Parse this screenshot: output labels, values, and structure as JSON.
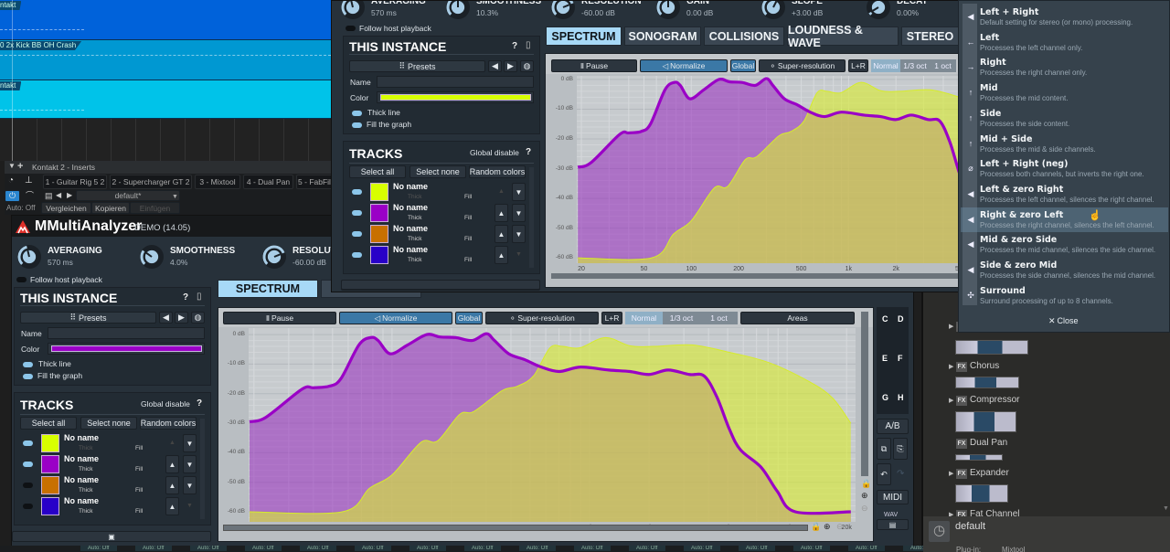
{
  "daw": {
    "clips": [
      "ntakt",
      "0 2x Kick BB OH Crash",
      "ntakt"
    ],
    "clip_colors": [
      "#0062da",
      "#0098d2",
      "#00c3e9"
    ]
  },
  "inserts": {
    "title": "Kontakt 2 - Inserts",
    "tabs": [
      "1 - Guitar Rig 5 2",
      "2 - Supercharger GT 2",
      "3 - Mixtool",
      "4 - Dual Pan",
      "5 - FabFil"
    ],
    "preset": "default*",
    "auto": "Auto: Off",
    "compare": "Vergleichen",
    "copy": "Kopieren",
    "paste": "Einfügen"
  },
  "plugin": {
    "name": "MMultiAnalyzer",
    "edition": "DEMO (14.05)"
  },
  "tracks_panel": {
    "title": "TRACKS",
    "global": "Global disable",
    "help": "?",
    "select_all": "Select all",
    "select_none": "Select none",
    "random": "Random colors",
    "thick": "Thick",
    "fill": "Fill",
    "items": [
      {
        "name": "No name",
        "color": "#d8ff00"
      },
      {
        "name": "No name",
        "color": "#9a00c6"
      },
      {
        "name": "No name",
        "color": "#c87000"
      },
      {
        "name": "No name",
        "color": "#2800c8"
      }
    ]
  },
  "instance_panel": {
    "title": "THIS INSTANCE",
    "help": "?",
    "presets": "Presets",
    "name_label": "Name",
    "color_label": "Color",
    "thick": "Thick line",
    "fill": "Fill the graph"
  },
  "toolbar": {
    "pause": "Pause",
    "normalize": "Normalize",
    "global": "Global",
    "superres": "Super-resolution",
    "lr": "L+R",
    "modes": [
      "Normal",
      "1/3 oct",
      "1 oct"
    ],
    "areas": "Areas"
  },
  "front": {
    "follow": "Follow host playback",
    "instance_color": "#9a00c6",
    "track_enabled": [
      true,
      true,
      false,
      false
    ],
    "knobs": [
      {
        "label": "AVERAGING",
        "value": "570 ms",
        "level": 0.45
      },
      {
        "label": "SMOOTHNESS",
        "value": "4.0%",
        "level": 0.3
      },
      {
        "label": "RESOLUTI",
        "value": "-60.00 dB",
        "level": 0.75
      }
    ],
    "tabs": [
      "SPECTRUM",
      "S"
    ],
    "side": {
      "slots": [
        "C",
        "D",
        "E",
        "F",
        "G",
        "H"
      ],
      "ab": "A/B",
      "midi": "MIDI",
      "wav": "WAV"
    }
  },
  "back": {
    "follow": "Follow host playback",
    "instance_color": "#d8ff00",
    "track_enabled": [
      true,
      true,
      true,
      true
    ],
    "knobs": [
      {
        "label": "AVERAGING",
        "value": "570 ms",
        "level": 0.45
      },
      {
        "label": "SMOOTHNESS",
        "value": "10.3%",
        "level": 0.5
      },
      {
        "label": "RESOLUTION",
        "value": "-60.00 dB",
        "level": 0.75
      },
      {
        "label": "GAIN",
        "value": "0.00 dB",
        "level": 0.5
      },
      {
        "label": "SLOPE",
        "value": "+3.00 dB",
        "level": 0.6
      },
      {
        "label": "DECAY",
        "value": "0.00%",
        "level": 0.05
      }
    ],
    "tabs": [
      "SPECTRUM",
      "SONOGRAM",
      "COLLISIONS",
      "LOUDNESS & WAVE",
      "STEREO"
    ]
  },
  "menu": {
    "highlighted": 8,
    "close": "Close",
    "items": [
      {
        "label": "Left + Right",
        "desc": "Default setting for stereo (or mono) processing.",
        "icon": "speaker-icon"
      },
      {
        "label": "Left",
        "desc": "Processes the left channel only.",
        "icon": "arrow-left-icon"
      },
      {
        "label": "Right",
        "desc": "Processes the right channel only.",
        "icon": "arrow-right-icon"
      },
      {
        "label": "Mid",
        "desc": "Processes the mid content.",
        "icon": "arrow-up-icon"
      },
      {
        "label": "Side",
        "desc": "Processes the side content.",
        "icon": "arrow-up-icon"
      },
      {
        "label": "Mid + Side",
        "desc": "Processes the mid & side channels.",
        "icon": "arrow-up-icon"
      },
      {
        "label": "Left + Right (neg)",
        "desc": "Processes both channels, but inverts the right one.",
        "icon": "phase-invert-icon"
      },
      {
        "label": "Left & zero Right",
        "desc": "Processes the left channel, silences the right channel.",
        "icon": "speaker-icon"
      },
      {
        "label": "Right & zero Left",
        "desc": "Processes the right channel, silences the left channel.",
        "icon": "speaker-icon"
      },
      {
        "label": "Mid & zero Side",
        "desc": "Processes the mid channel, silences the side channel.",
        "icon": "speaker-icon"
      },
      {
        "label": "Side & zero Mid",
        "desc": "Processes the side channel, silences the mid channel.",
        "icon": "speaker-icon"
      },
      {
        "label": "Surround",
        "desc": "Surround processing of up to 8 channels.",
        "icon": "surround-icon"
      }
    ]
  },
  "browser": {
    "items": [
      {
        "label": "",
        "arrow": true
      },
      {
        "label": "Chorus",
        "arrow": true
      },
      {
        "label": "Compressor",
        "arrow": true
      },
      {
        "label": "Dual Pan",
        "arrow": false
      },
      {
        "label": "Expander",
        "arrow": true
      },
      {
        "label": "Fat Channel",
        "arrow": true
      }
    ],
    "badge": "FX",
    "footer": {
      "name": "default",
      "plugin_label": "Plug-in:",
      "plugin_value": "Mixtool"
    }
  },
  "bottom_strip": [
    "Auto: Off",
    "Auto: Off",
    "Auto: Off",
    "Auto: Off",
    "Auto: Off",
    "Auto: Off",
    "Auto: Off",
    "Auto: Off",
    "Auto: Off",
    "Auto: Off",
    "Auto: Off",
    "Auto: Off",
    "Auto: Off",
    "Auto: Off",
    "Auto: Off",
    "Auto: Off"
  ],
  "chart_data": {
    "type": "area",
    "x_scale": "log",
    "xlabel": "",
    "ylabel": "",
    "grid": true,
    "x_ticks": [
      "20",
      "50",
      "100",
      "200",
      "500",
      "1k",
      "2k",
      "5k",
      "10k",
      "20k"
    ],
    "x_tick_values": [
      20,
      50,
      100,
      200,
      500,
      1000,
      2000,
      5000,
      10000,
      20000
    ],
    "y_ticks": [
      "0 dB",
      "-10 dB",
      "-20 dB",
      "-30 dB",
      "-40 dB",
      "-50 dB",
      "-60 dB"
    ],
    "y_tick_values": [
      0,
      -10,
      -20,
      -30,
      -40,
      -50,
      -60
    ],
    "xlim": [
      19,
      22000
    ],
    "ylim": [
      -63,
      2
    ],
    "series": [
      {
        "color": "#9a00c6",
        "thick": true,
        "fill": true,
        "points": [
          [
            19,
            -29.5
          ],
          [
            23,
            -28
          ],
          [
            35,
            -18.5
          ],
          [
            40,
            -18
          ],
          [
            48,
            -17.5
          ],
          [
            55,
            -15
          ],
          [
            68,
            -3.5
          ],
          [
            78,
            -1
          ],
          [
            85,
            -2
          ],
          [
            98,
            -6.5
          ],
          [
            120,
            -3.5
          ],
          [
            150,
            0
          ],
          [
            175,
            -0.8
          ],
          [
            210,
            -1
          ],
          [
            255,
            -2
          ],
          [
            300,
            0.3
          ],
          [
            330,
            -2
          ],
          [
            390,
            -6.5
          ],
          [
            470,
            -8.5
          ],
          [
            570,
            -11
          ],
          [
            700,
            -12.5
          ],
          [
            900,
            -11
          ],
          [
            1250,
            -12
          ],
          [
            1600,
            -12.5
          ],
          [
            2000,
            -13.5
          ],
          [
            2500,
            -12
          ],
          [
            3200,
            -13.5
          ],
          [
            3800,
            -14
          ],
          [
            4400,
            -21
          ],
          [
            5100,
            -32
          ],
          [
            5800,
            -39
          ],
          [
            7400,
            -45
          ],
          [
            8900,
            -53
          ],
          [
            11000,
            -60
          ],
          [
            21000,
            -60
          ]
        ]
      },
      {
        "color": "#d6ec2a",
        "thick": false,
        "fill": true,
        "points": [
          [
            19,
            -60
          ],
          [
            56,
            -60
          ],
          [
            77,
            -52
          ],
          [
            100,
            -47.5
          ],
          [
            140,
            -36.5
          ],
          [
            170,
            -36
          ],
          [
            220,
            -27
          ],
          [
            260,
            -26
          ],
          [
            360,
            -19
          ],
          [
            430,
            -17.5
          ],
          [
            520,
            -14
          ],
          [
            630,
            -4.5
          ],
          [
            730,
            -4
          ],
          [
            890,
            -4.5
          ],
          [
            1200,
            -1
          ],
          [
            1600,
            -3.8
          ],
          [
            2100,
            -4
          ],
          [
            3300,
            -3.5
          ],
          [
            5100,
            -6
          ],
          [
            8100,
            -9.5
          ],
          [
            13000,
            -16
          ],
          [
            17000,
            -21.5
          ],
          [
            21000,
            -30
          ]
        ]
      }
    ]
  }
}
